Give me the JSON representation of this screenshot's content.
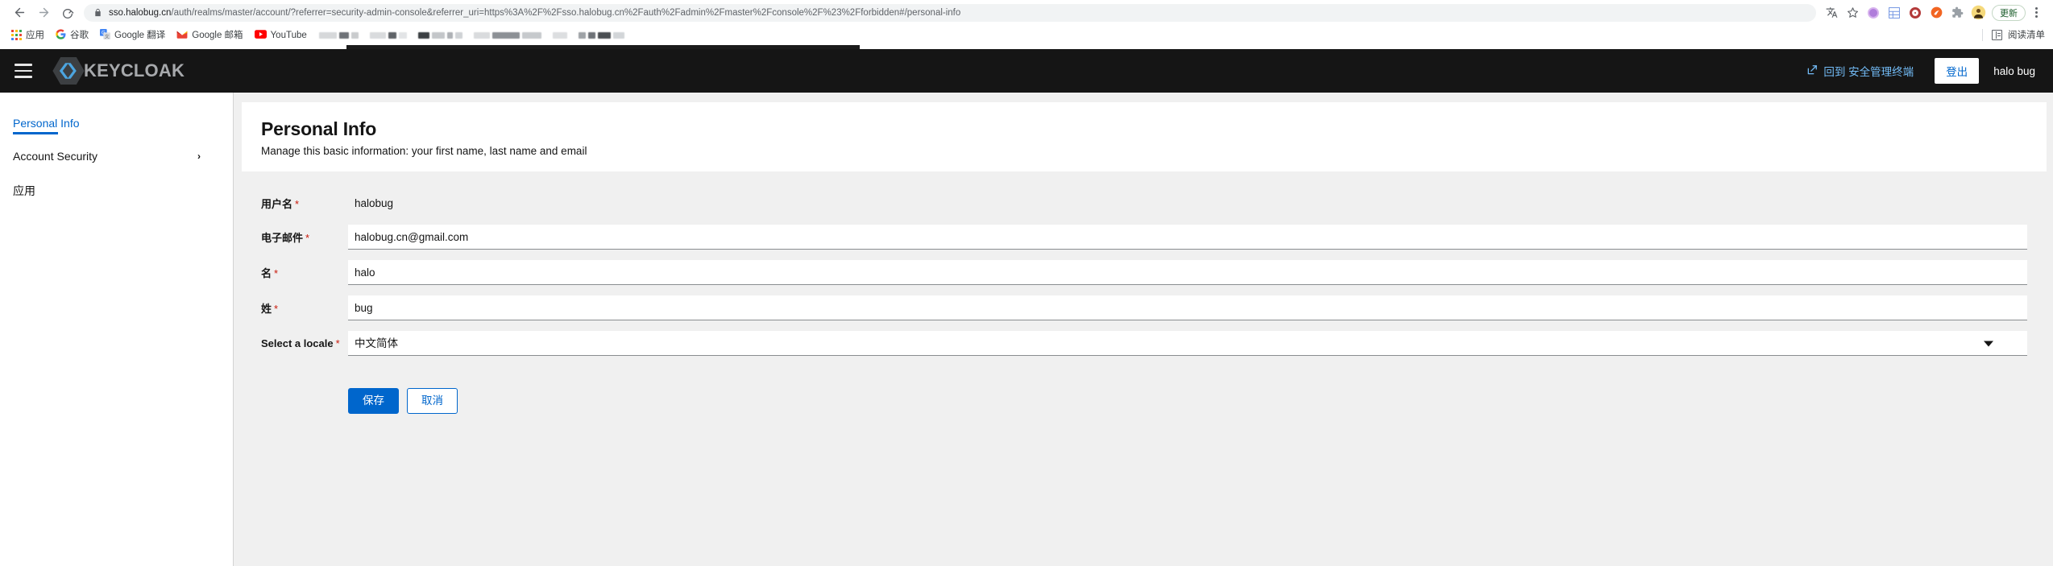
{
  "browser": {
    "url_host": "sso.halobug.cn",
    "url_path": "/auth/realms/master/account/?referrer=security-admin-console&referrer_uri=https%3A%2F%2Fsso.halobug.cn%2Fauth%2Fadmin%2Fmaster%2Fconsole%2F%23%2Fforbidden#/personal-info",
    "nav": {
      "back_label": "back-arrow",
      "forward_label": "forward-arrow",
      "reload_label": "reload"
    },
    "icons": {
      "lock": "lock-icon",
      "translate": "translate-icon",
      "bookmark_star": "star-icon",
      "extension_puzzle": "puzzle-icon",
      "profile_avatar": "avatar-icon"
    },
    "update_label": "更新",
    "bookmarks": [
      {
        "label": "应用",
        "icon": "apps-grid-icon"
      },
      {
        "label": "谷歌",
        "icon": "google-g-icon"
      },
      {
        "label": "Google 翻译",
        "icon": "google-translate-icon"
      },
      {
        "label": "Google 邮箱",
        "icon": "gmail-icon"
      },
      {
        "label": "YouTube",
        "icon": "youtube-icon"
      }
    ],
    "reading_list_label": "阅读清单"
  },
  "masthead": {
    "brand_text": "KEYCLOAK",
    "menu_icon": "hamburger-icon",
    "back_to_console_label": "回到 安全管理终端",
    "back_to_console_icon": "external-link-icon",
    "logout_label": "登出",
    "username": "halo bug"
  },
  "sidebar": {
    "items": [
      {
        "label": "Personal Info",
        "active": true,
        "chevron": ""
      },
      {
        "label": "Account Security",
        "active": false,
        "chevron": "›"
      },
      {
        "label": "应用",
        "active": false,
        "chevron": ""
      }
    ]
  },
  "page": {
    "title": "Personal Info",
    "subtitle": "Manage this basic information: your first name, last name and email"
  },
  "form": {
    "fields": [
      {
        "label": "用户名",
        "required": true,
        "type": "readonly",
        "value": "halobug"
      },
      {
        "label": "电子邮件",
        "required": true,
        "type": "text",
        "value": "halobug.cn@gmail.com"
      },
      {
        "label": "名",
        "required": true,
        "type": "text",
        "value": "halo"
      },
      {
        "label": "姓",
        "required": true,
        "type": "text",
        "value": "bug"
      },
      {
        "label": "Select a locale",
        "required": true,
        "type": "select",
        "value": "中文简体"
      }
    ],
    "required_mark": "*",
    "save_label": "保存",
    "cancel_label": "取消"
  },
  "colors": {
    "accent": "#0066cc",
    "masthead_bg": "#151515",
    "required_red": "#c9190b",
    "page_bg": "#f0f0f0"
  }
}
